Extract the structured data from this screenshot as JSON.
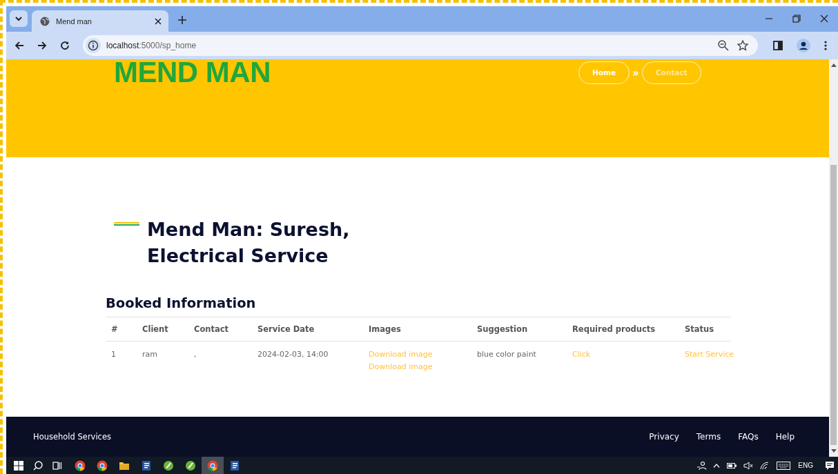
{
  "browser": {
    "tab_title": "Mend man",
    "url": {
      "host": "localhost",
      "path": ":5000/sp_home"
    }
  },
  "header": {
    "logo": "MEND MAN",
    "nav": [
      {
        "label": "Home",
        "selected": true
      },
      {
        "label": "Contact",
        "selected": false
      }
    ],
    "separator": "»"
  },
  "title": "Mend Man: Suresh, Electrical Service",
  "section_heading": "Booked Information",
  "table": {
    "columns": [
      "#",
      "Client",
      "Contact",
      "Service Date",
      "Images",
      "Suggestion",
      "Required products",
      "Status"
    ],
    "rows": [
      {
        "cells": [
          {
            "kind": "text",
            "texts": [
              "1"
            ]
          },
          {
            "kind": "text",
            "texts": [
              "ram"
            ]
          },
          {
            "kind": "text",
            "texts": [
              ","
            ]
          },
          {
            "kind": "text",
            "texts": [
              "2024-02-03, 14:00"
            ]
          },
          {
            "kind": "link",
            "texts": [
              "Download image",
              "Download image"
            ]
          },
          {
            "kind": "text",
            "texts": [
              "blue color paint"
            ]
          },
          {
            "kind": "link",
            "texts": [
              "Click"
            ]
          },
          {
            "kind": "link",
            "texts": [
              "Start Service"
            ]
          }
        ]
      }
    ]
  },
  "footer": {
    "brand": "Household Services",
    "links": [
      "Privacy",
      "Terms",
      "FAQs",
      "Help"
    ]
  },
  "taskbar": {
    "apps": [
      {
        "kind": "browser",
        "active": false
      },
      {
        "kind": "browser",
        "active": false
      },
      {
        "kind": "folder",
        "active": false
      },
      {
        "kind": "document",
        "active": false
      },
      {
        "kind": "app",
        "active": false
      },
      {
        "kind": "app",
        "active": false
      },
      {
        "kind": "browser",
        "active": true
      },
      {
        "kind": "document",
        "active": false
      }
    ],
    "language": "ENG"
  }
}
